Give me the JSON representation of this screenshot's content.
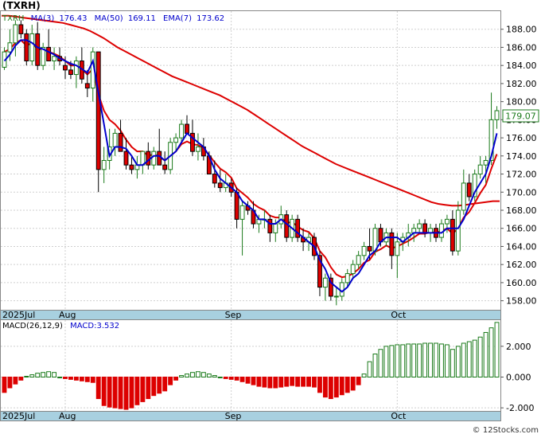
{
  "title": "(TXRH)",
  "legend": {
    "ticker": "TXRH",
    "ma3": "MA(3)",
    "ma3_val": "176.43",
    "ma50": "MA(50)",
    "ma50_val": "169.11",
    "ema7": "EMA(7)",
    "ema7_val": "173.62"
  },
  "last_price_label": "179.07",
  "macd_legend": {
    "params": "MACD(26,12,9)",
    "value": "MACD:3.532"
  },
  "watermark": "© 12Stocks.com",
  "colors": {
    "up": "#1a7a1a",
    "down": "#dd0000",
    "ma3": "#0000cc",
    "ma50": "#dd0000",
    "ema7": "#dd0000",
    "axis_band": "#a8d0e0"
  },
  "chart_data": [
    {
      "type": "candlestick",
      "title": "(TXRH)",
      "ylim": [
        157,
        190
      ],
      "yticks": [
        158,
        160,
        162,
        164,
        166,
        168,
        170,
        172,
        174,
        176,
        178,
        180,
        182,
        184,
        186,
        188
      ],
      "ytick_labels": [
        "158.00",
        "160.00",
        "162.00",
        "164.00",
        "166.00",
        "168.00",
        "170.00",
        "172.00",
        "174.00",
        "176.00",
        "178.00",
        "180.00",
        "182.00",
        "184.00",
        "186.00",
        "188.00"
      ],
      "x_month_labels": [
        {
          "label": "2025Jul",
          "index": 0
        },
        {
          "label": "Aug",
          "index": 11
        },
        {
          "label": "Sep",
          "index": 41
        },
        {
          "label": "Oct",
          "index": 71
        }
      ],
      "ohlc": [
        [
          183.8,
          186.0,
          183.5,
          185.5
        ],
        [
          185.5,
          188.0,
          184.5,
          186.5
        ],
        [
          186.5,
          189.0,
          185.0,
          188.5
        ],
        [
          188.5,
          189.0,
          187.0,
          187.5
        ],
        [
          187.5,
          188.0,
          184.0,
          184.5
        ],
        [
          184.5,
          188.5,
          184.0,
          187.5
        ],
        [
          187.5,
          188.8,
          183.5,
          184.0
        ],
        [
          184.0,
          186.5,
          183.5,
          186.0
        ],
        [
          186.0,
          188.0,
          184.5,
          184.5
        ],
        [
          184.5,
          186.0,
          183.5,
          185.0
        ],
        [
          185.0,
          186.0,
          184.0,
          184.5
        ],
        [
          184.0,
          185.0,
          182.5,
          183.5
        ],
        [
          183.5,
          184.5,
          182.5,
          183.0
        ],
        [
          183.0,
          185.0,
          181.5,
          184.5
        ],
        [
          184.5,
          186.0,
          182.0,
          182.5
        ],
        [
          182.0,
          183.5,
          180.5,
          181.5
        ],
        [
          181.5,
          186.0,
          180.0,
          185.5
        ],
        [
          185.5,
          185.0,
          170.0,
          172.5
        ],
        [
          172.5,
          175.0,
          171.0,
          173.5
        ],
        [
          173.5,
          177.0,
          172.5,
          175.0
        ],
        [
          175.0,
          177.0,
          174.0,
          176.5
        ],
        [
          176.5,
          178.0,
          174.5,
          174.5
        ],
        [
          174.5,
          176.0,
          172.5,
          173.0
        ],
        [
          173.0,
          174.0,
          172.0,
          172.5
        ],
        [
          172.5,
          174.0,
          171.5,
          173.0
        ],
        [
          173.0,
          174.5,
          172.0,
          174.5
        ],
        [
          174.5,
          175.5,
          172.5,
          173.0
        ],
        [
          173.0,
          175.0,
          172.5,
          174.5
        ],
        [
          174.5,
          177.0,
          173.0,
          173.0
        ],
        [
          173.0,
          174.5,
          172.0,
          172.5
        ],
        [
          172.5,
          176.0,
          172.0,
          175.5
        ],
        [
          175.5,
          176.5,
          174.5,
          176.0
        ],
        [
          176.0,
          178.0,
          175.5,
          177.5
        ],
        [
          177.5,
          178.5,
          176.5,
          176.5
        ],
        [
          176.5,
          178.0,
          174.0,
          174.5
        ],
        [
          174.5,
          176.5,
          173.5,
          175.0
        ],
        [
          175.0,
          176.0,
          173.5,
          174.0
        ],
        [
          174.0,
          174.5,
          172.0,
          172.0
        ],
        [
          172.0,
          173.5,
          170.5,
          171.0
        ],
        [
          171.0,
          172.5,
          170.0,
          170.5
        ],
        [
          170.5,
          172.0,
          170.0,
          171.0
        ],
        [
          171.0,
          171.5,
          169.5,
          170.0
        ],
        [
          170.0,
          170.5,
          166.0,
          167.0
        ],
        [
          167.0,
          169.0,
          163.0,
          168.5
        ],
        [
          168.5,
          169.0,
          167.5,
          168.0
        ],
        [
          168.0,
          169.0,
          166.0,
          166.5
        ],
        [
          166.5,
          167.5,
          165.5,
          167.0
        ],
        [
          167.0,
          168.0,
          166.0,
          167.0
        ],
        [
          167.0,
          167.5,
          164.5,
          165.5
        ],
        [
          165.5,
          167.0,
          164.5,
          166.5
        ],
        [
          166.5,
          168.5,
          166.0,
          167.5
        ],
        [
          167.5,
          168.0,
          164.5,
          165.0
        ],
        [
          165.0,
          167.5,
          164.5,
          167.0
        ],
        [
          167.0,
          167.5,
          164.5,
          165.0
        ],
        [
          165.0,
          166.0,
          163.5,
          164.5
        ],
        [
          164.5,
          165.5,
          163.5,
          165.0
        ],
        [
          165.0,
          165.5,
          162.5,
          163.0
        ],
        [
          163.0,
          163.5,
          158.5,
          159.5
        ],
        [
          159.5,
          161.0,
          158.0,
          160.5
        ],
        [
          160.5,
          161.0,
          158.0,
          158.5
        ],
        [
          158.5,
          159.5,
          157.5,
          158.5
        ],
        [
          158.5,
          160.5,
          158.0,
          160.0
        ],
        [
          160.0,
          161.5,
          159.5,
          161.0
        ],
        [
          161.0,
          162.5,
          160.5,
          162.0
        ],
        [
          162.0,
          163.5,
          161.5,
          163.0
        ],
        [
          163.0,
          164.5,
          162.5,
          164.0
        ],
        [
          164.0,
          166.0,
          162.5,
          163.5
        ],
        [
          163.5,
          166.5,
          163.0,
          166.0
        ],
        [
          166.0,
          166.5,
          164.0,
          164.5
        ],
        [
          164.5,
          166.0,
          164.0,
          165.5
        ],
        [
          165.5,
          166.0,
          161.5,
          163.0
        ],
        [
          163.0,
          165.5,
          160.5,
          164.5
        ],
        [
          164.5,
          165.5,
          163.5,
          165.0
        ],
        [
          165.0,
          166.5,
          164.0,
          165.5
        ],
        [
          165.5,
          166.5,
          164.5,
          166.0
        ],
        [
          166.0,
          167.0,
          165.5,
          166.5
        ],
        [
          166.5,
          167.0,
          165.0,
          165.5
        ],
        [
          165.5,
          166.5,
          164.5,
          166.0
        ],
        [
          166.0,
          166.5,
          164.5,
          165.0
        ],
        [
          165.0,
          167.0,
          164.5,
          166.5
        ],
        [
          166.5,
          167.5,
          165.5,
          167.0
        ],
        [
          167.0,
          168.0,
          163.0,
          163.5
        ],
        [
          163.5,
          169.0,
          163.0,
          168.0
        ],
        [
          168.0,
          172.5,
          167.5,
          171.0
        ],
        [
          171.0,
          172.0,
          169.0,
          169.5
        ],
        [
          169.5,
          172.5,
          169.0,
          172.0
        ],
        [
          172.0,
          174.0,
          171.5,
          173.0
        ],
        [
          173.0,
          174.0,
          171.0,
          173.5
        ],
        [
          173.5,
          181.0,
          173.0,
          178.0
        ],
        [
          178.0,
          179.5,
          177.0,
          179.0
        ]
      ],
      "ma3": [
        184.5,
        185.2,
        186.2,
        186.8,
        186.8,
        186.5,
        186.0,
        185.8,
        185.5,
        185.2,
        184.8,
        184.5,
        184.2,
        184.0,
        183.6,
        183.2,
        184.5,
        181.0,
        177.5,
        174.0,
        175.0,
        175.0,
        174.8,
        174.0,
        173.0,
        173.0,
        173.5,
        174.0,
        174.0,
        173.5,
        174.0,
        174.5,
        175.5,
        176.5,
        176.0,
        175.5,
        175.0,
        174.0,
        172.5,
        171.5,
        171.0,
        170.5,
        170.0,
        169.0,
        168.5,
        168.0,
        167.0,
        167.0,
        166.5,
        166.5,
        167.0,
        166.5,
        166.0,
        165.5,
        165.0,
        164.5,
        164.0,
        162.5,
        161.5,
        160.0,
        159.5,
        159.0,
        159.5,
        160.5,
        161.0,
        162.0,
        163.0,
        163.5,
        164.5,
        165.0,
        165.0,
        165.0,
        164.5,
        165.0,
        165.5,
        165.5,
        165.5,
        165.5,
        165.5,
        165.5,
        166.0,
        166.0,
        166.0,
        167.0,
        168.5,
        170.0,
        171.0,
        172.0,
        174.0,
        176.5
      ],
      "ma50": [
        189.5,
        189.5,
        189.4,
        189.3,
        189.2,
        189.1,
        189.0,
        188.9,
        188.8,
        188.7,
        188.5,
        188.3,
        188.1,
        187.8,
        187.4,
        187.0,
        186.5,
        186.0,
        185.6,
        185.2,
        184.8,
        184.4,
        184.0,
        183.6,
        183.2,
        182.8,
        182.5,
        182.2,
        181.9,
        181.6,
        181.3,
        181.0,
        180.7,
        180.3,
        179.9,
        179.5,
        179.1,
        178.6,
        178.1,
        177.6,
        177.1,
        176.6,
        176.1,
        175.6,
        175.1,
        174.7,
        174.3,
        173.9,
        173.5,
        173.1,
        172.8,
        172.5,
        172.2,
        171.9,
        171.6,
        171.3,
        171.0,
        170.7,
        170.4,
        170.1,
        169.8,
        169.5,
        169.2,
        168.9,
        168.7,
        168.6,
        168.5,
        168.5,
        168.6,
        168.7,
        168.8,
        168.9,
        169.0,
        169.0
      ],
      "ma50_start_index": 0,
      "ema7": [
        185.5,
        185.8,
        186.5,
        186.8,
        186.2,
        186.5,
        185.8,
        185.8,
        185.5,
        185.3,
        185.0,
        184.5,
        184.0,
        184.0,
        183.6,
        183.0,
        183.6,
        180.8,
        179.0,
        178.0,
        177.5,
        176.8,
        175.8,
        175.0,
        174.5,
        174.5,
        174.0,
        174.2,
        173.9,
        173.5,
        174.0,
        174.5,
        175.3,
        175.6,
        175.3,
        175.2,
        174.9,
        174.1,
        173.3,
        172.6,
        172.2,
        171.6,
        170.4,
        169.9,
        169.4,
        168.7,
        168.3,
        168.0,
        167.4,
        167.2,
        167.2,
        166.6,
        166.7,
        166.2,
        165.8,
        165.6,
        164.9,
        163.5,
        162.8,
        161.7,
        160.9,
        160.6,
        160.7,
        161.0,
        161.5,
        162.2,
        162.5,
        163.4,
        163.7,
        164.1,
        163.8,
        164.0,
        164.3,
        164.6,
        165.0,
        165.4,
        165.4,
        165.6,
        165.5,
        165.7,
        166.0,
        165.4,
        166.0,
        167.2,
        167.8,
        168.8,
        169.9,
        170.8,
        172.6,
        174.2
      ]
    },
    {
      "type": "bar",
      "title": "MACD(26,12,9)",
      "value_label": "MACD:3.532",
      "ylim": [
        -2.2,
        3.7
      ],
      "yticks": [
        -2,
        0,
        2
      ],
      "ytick_labels": [
        "-2.000",
        "0.000",
        "2.000"
      ],
      "x_month_labels": [
        {
          "label": "2025Jul",
          "index": 0
        },
        {
          "label": "Aug",
          "index": 11
        },
        {
          "label": "Sep",
          "index": 41
        },
        {
          "label": "Oct",
          "index": 71
        }
      ],
      "values": [
        -1.0,
        -0.7,
        -0.45,
        -0.2,
        0.05,
        0.15,
        0.25,
        0.3,
        0.35,
        0.3,
        0.0,
        -0.1,
        -0.15,
        -0.2,
        -0.25,
        -0.3,
        -0.35,
        -1.4,
        -1.85,
        -1.95,
        -2.0,
        -2.05,
        -2.1,
        -2.0,
        -1.8,
        -1.6,
        -1.4,
        -1.2,
        -1.05,
        -0.9,
        -0.5,
        -0.2,
        0.1,
        0.2,
        0.3,
        0.35,
        0.3,
        0.2,
        0.1,
        0.0,
        -0.1,
        -0.15,
        -0.2,
        -0.3,
        -0.4,
        -0.5,
        -0.6,
        -0.65,
        -0.7,
        -0.7,
        -0.65,
        -0.6,
        -0.55,
        -0.6,
        -0.6,
        -0.6,
        -0.65,
        -1.0,
        -1.3,
        -1.4,
        -1.3,
        -1.15,
        -1.0,
        -0.85,
        -0.5,
        0.2,
        1.0,
        1.5,
        1.8,
        2.0,
        2.05,
        2.1,
        2.1,
        2.15,
        2.15,
        2.15,
        2.2,
        2.2,
        2.2,
        2.15,
        2.1,
        1.8,
        2.0,
        2.2,
        2.3,
        2.4,
        2.6,
        2.9,
        3.2,
        3.55
      ]
    }
  ]
}
